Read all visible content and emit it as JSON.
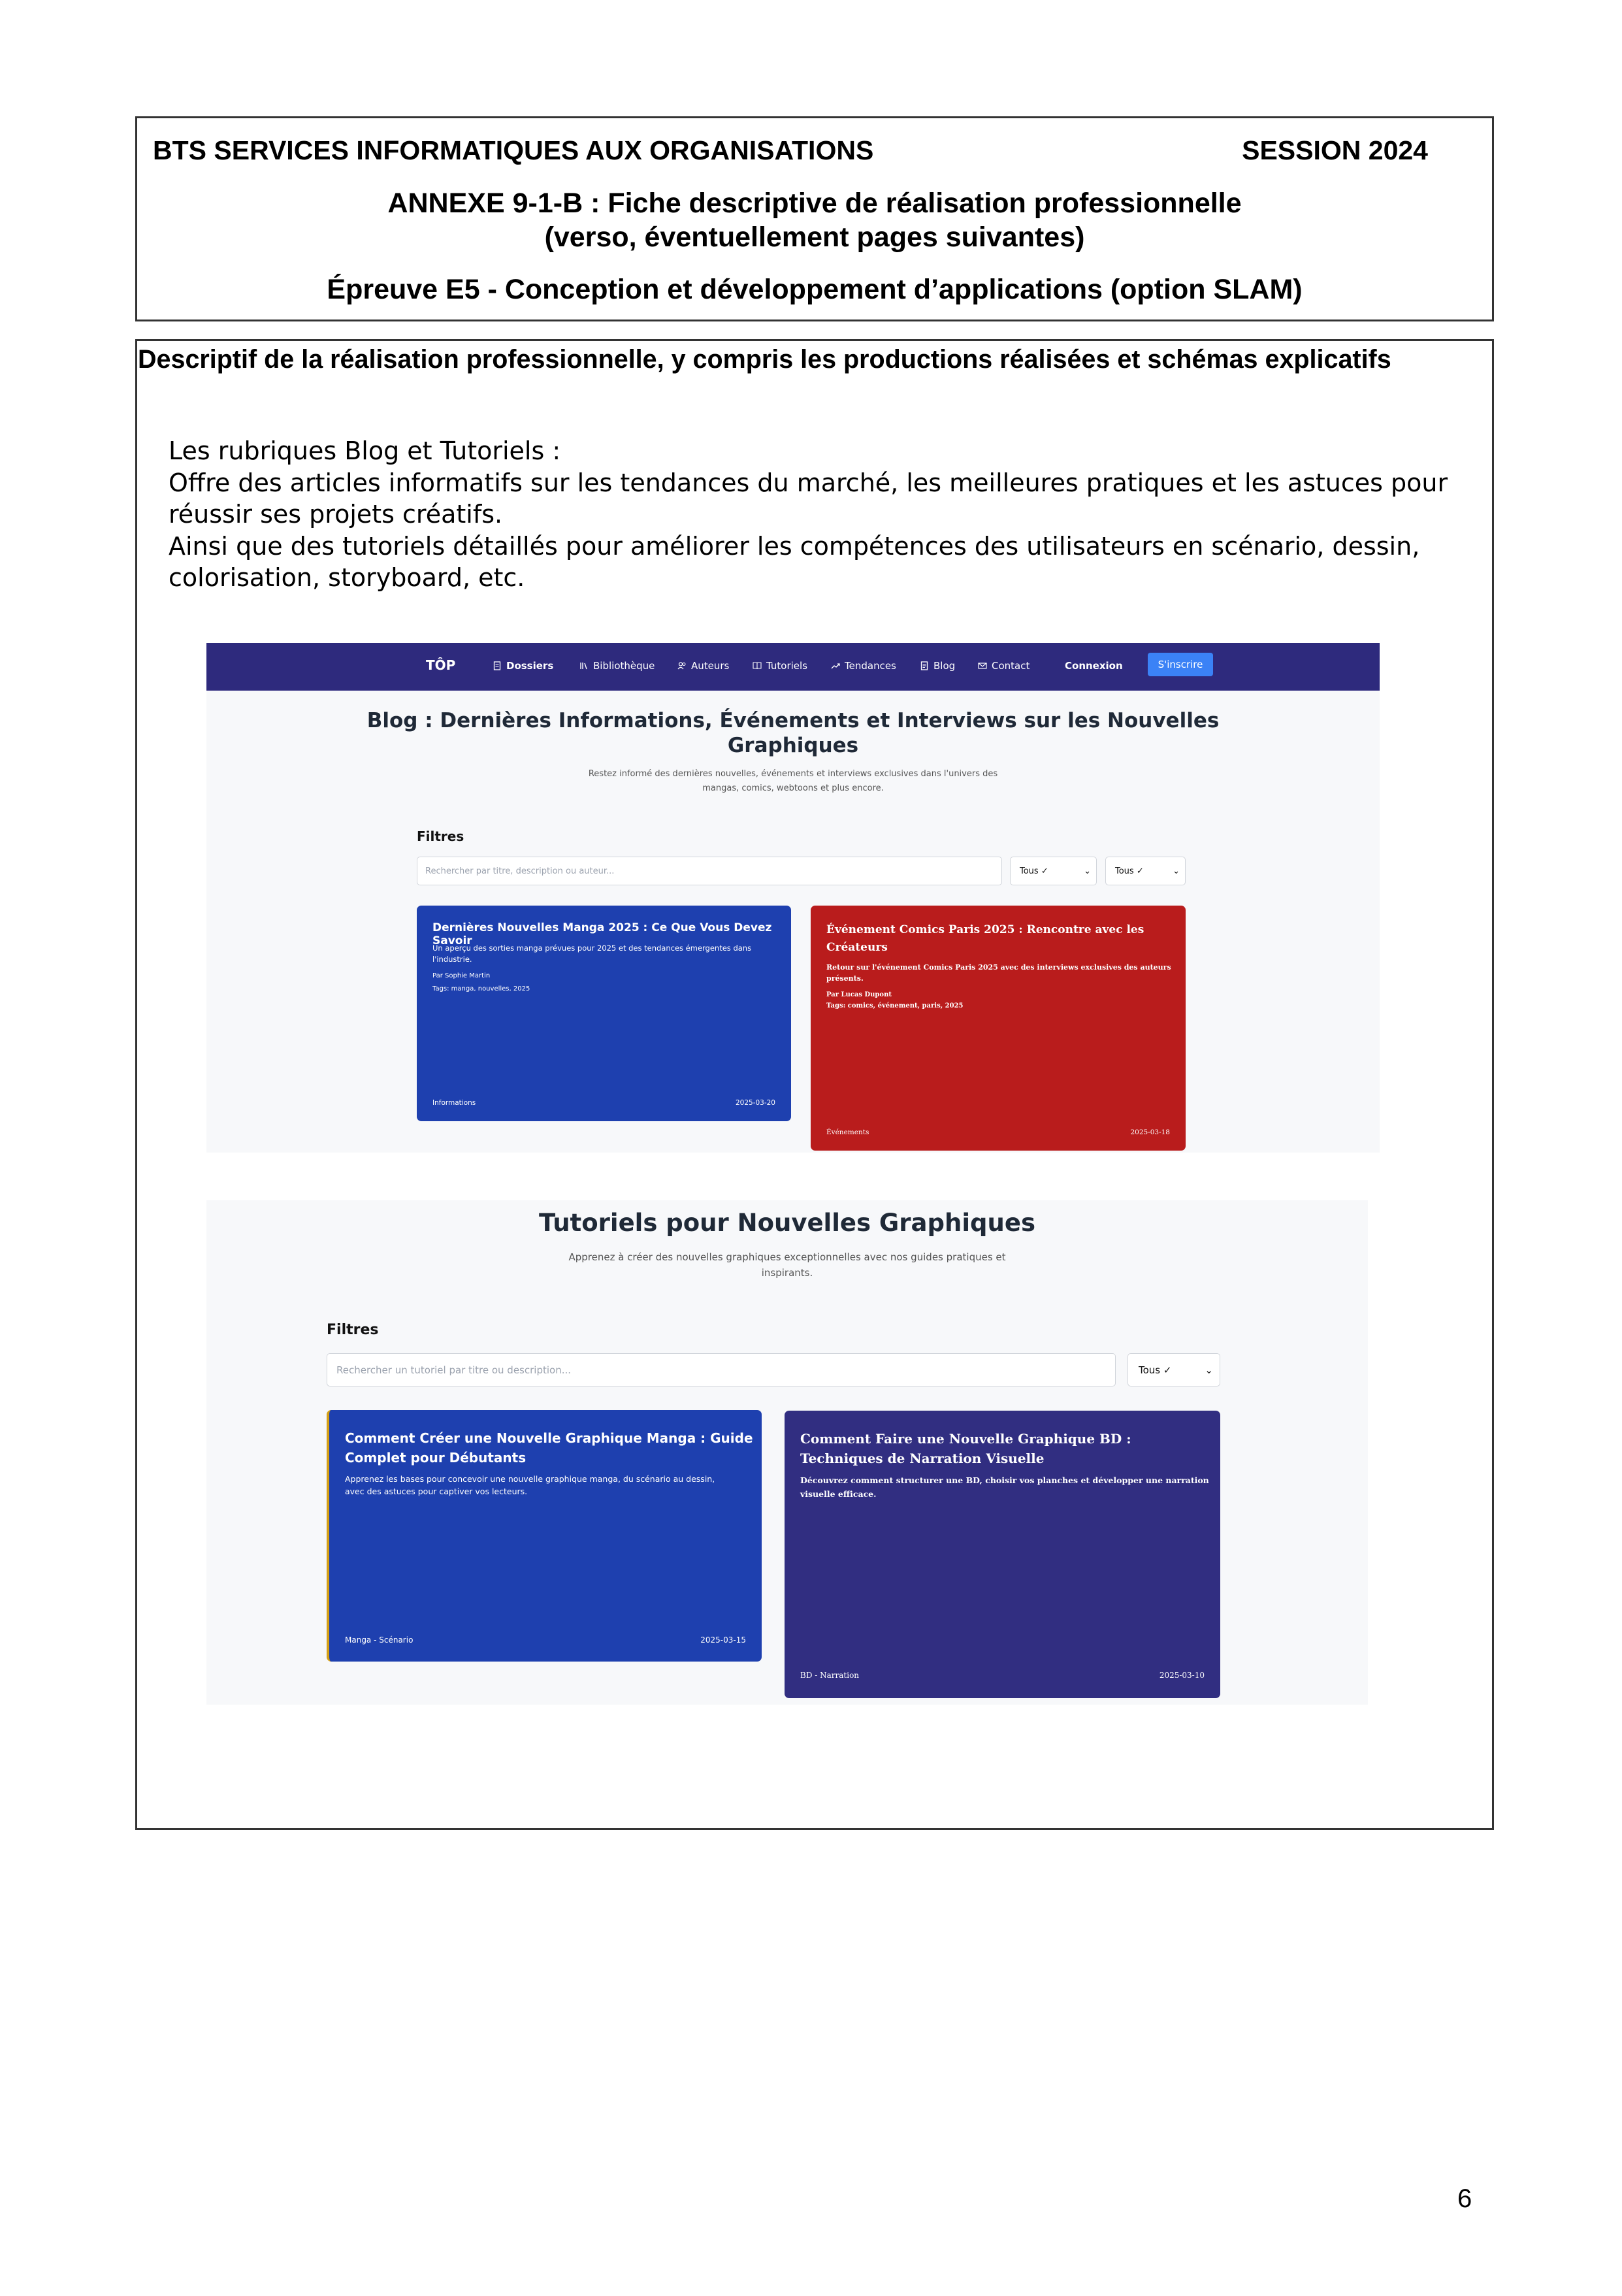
{
  "header": {
    "program": "BTS SERVICES INFORMATIQUES AUX ORGANISATIONS",
    "session": "SESSION 2024",
    "annex_title": "ANNEXE 9-1-B : Fiche descriptive de réalisation professionnelle",
    "annex_subtitle": "(verso, éventuellement pages suivantes)",
    "exam": "Épreuve E5 - Conception et développement d’applications (option SLAM)"
  },
  "section": {
    "title": "Descriptif de la réalisation professionnelle, y compris les productions réalisées et schémas explicatifs",
    "intro": [
      "Les rubriques Blog et Tutoriels :",
      "Offre des articles informatifs sur les tendances du marché, les meilleures pratiques et les astuces pour",
      "réussir ses projets créatifs.",
      "Ainsi que des tutoriels détaillés pour améliorer les compétences des utilisateurs en scénario, dessin,",
      "colorisation, storyboard, etc."
    ]
  },
  "blog_screenshot": {
    "nav": {
      "brand": "TÔP",
      "items": [
        "Dossiers",
        "Bibliothèque",
        "Auteurs",
        "Tutoriels",
        "Tendances",
        "Blog",
        "Contact"
      ],
      "icons": [
        "file-icon",
        "library-icon",
        "users-icon",
        "book-icon",
        "trending-icon",
        "document-icon",
        "mail-icon"
      ],
      "login": "Connexion",
      "signup": "S'inscrire"
    },
    "title_line1": "Blog : Dernières Informations, Événements et Interviews sur les Nouvelles",
    "title_line2": "Graphiques",
    "subtitle_line1": "Restez informé des dernières nouvelles, événements et interviews exclusives dans l'univers des",
    "subtitle_line2": "mangas, comics, webtoons et plus encore.",
    "filters_label": "Filtres",
    "search_placeholder": "Rechercher par titre, description ou auteur...",
    "select1": "Tous ✓",
    "select2": "Tous ✓",
    "cards": [
      {
        "title": "Dernières Nouvelles Manga 2025 : Ce Que Vous Devez Savoir",
        "desc_line1": "Un aperçu des sorties manga prévues pour 2025 et des tendances émergentes dans",
        "desc_line2": "l'industrie.",
        "author": "Par Sophie Martin",
        "tags": "Tags: manga, nouvelles, 2025",
        "category": "Informations",
        "date": "2025-03-20",
        "color": "#1e40af"
      },
      {
        "title_line1": "Événement Comics Paris 2025 : Rencontre avec les",
        "title_line2": "Créateurs",
        "desc_line1": "Retour sur l'événement Comics Paris 2025 avec des interviews exclusives des auteurs",
        "desc_line2": "présents.",
        "author": "Par Lucas Dupont",
        "tags": "Tags: comics, événement, paris, 2025",
        "category": "Événements",
        "date": "2025-03-18",
        "color": "#b91c1c"
      }
    ]
  },
  "tutorials_screenshot": {
    "title": "Tutoriels pour Nouvelles Graphiques",
    "subtitle_line1": "Apprenez à créer des nouvelles graphiques exceptionnelles avec nos guides pratiques et",
    "subtitle_line2": "inspirants.",
    "filters_label": "Filtres",
    "search_placeholder": "Rechercher un tutoriel par titre ou description...",
    "select1": "Tous ✓",
    "cards": [
      {
        "title_line1": "Comment Créer une Nouvelle Graphique Manga : Guide",
        "title_line2": "Complet pour Débutants",
        "desc_line1": "Apprenez les bases pour concevoir une nouvelle graphique manga, du scénario au dessin,",
        "desc_line2": "avec des astuces pour captiver vos lecteurs.",
        "category": "Manga - Scénario",
        "date": "2025-03-15",
        "color": "#1e40af"
      },
      {
        "title_line1": "Comment Faire une Nouvelle Graphique BD :",
        "title_line2": "Techniques de Narration Visuelle",
        "desc_line1": "Découvrez comment structurer une BD, choisir vos planches et développer une narration",
        "desc_line2": "visuelle efficace.",
        "category": "BD - Narration",
        "date": "2025-03-10",
        "color": "#312e81"
      }
    ]
  },
  "page_number": "6"
}
